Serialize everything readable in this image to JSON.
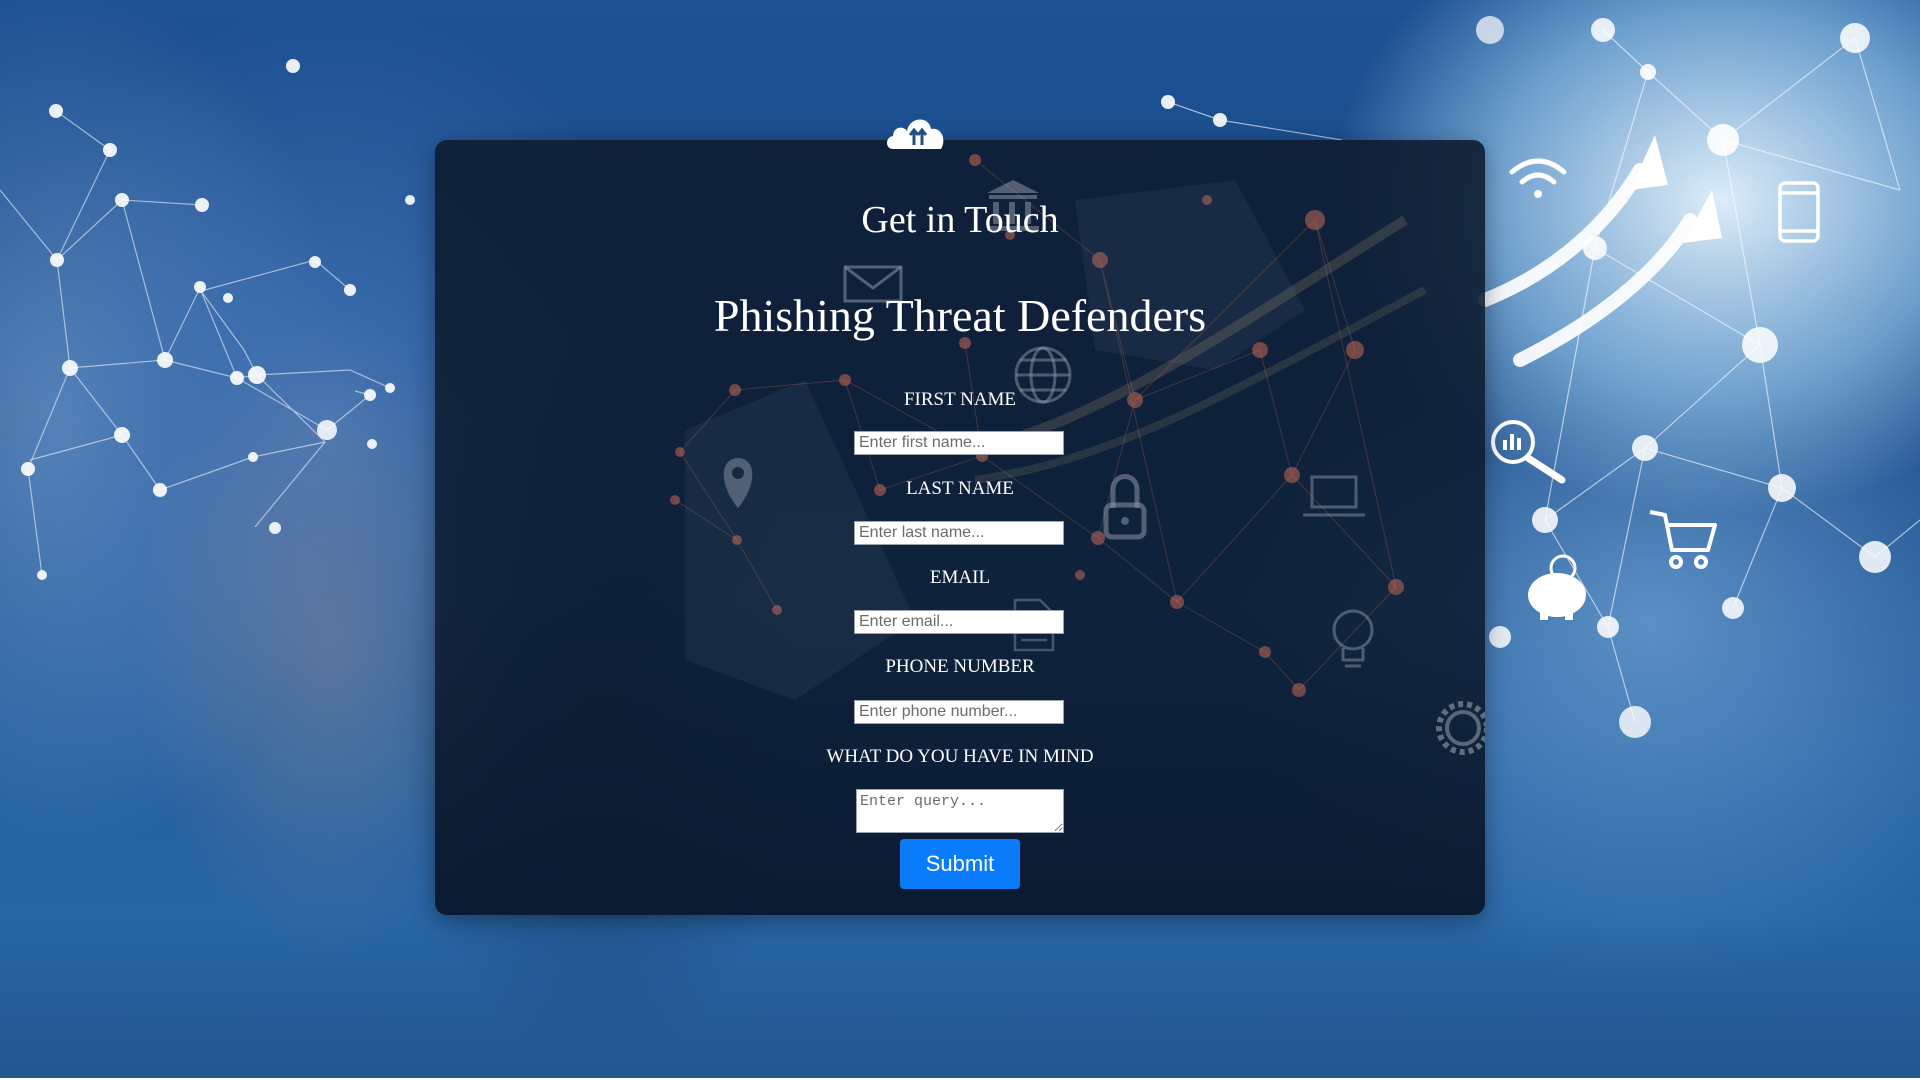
{
  "header": {
    "title": "Get in Touch",
    "subtitle": "Phishing Threat Defenders"
  },
  "form": {
    "fields": [
      {
        "label": "FIRST NAME",
        "placeholder": "Enter first name..."
      },
      {
        "label": "LAST NAME",
        "placeholder": "Enter last name..."
      },
      {
        "label": "EMAIL",
        "placeholder": "Enter email..."
      },
      {
        "label": "PHONE NUMBER",
        "placeholder": "Enter phone number..."
      }
    ],
    "query": {
      "label": "WHAT DO YOU HAVE IN MIND",
      "placeholder": "Enter query..."
    },
    "submit_label": "Submit"
  },
  "colors": {
    "accent": "#0a7bfa",
    "card": "#0e1c30",
    "background": "#1d5193"
  },
  "icons": [
    "cloud-upload-icon",
    "bank-icon",
    "envelope-icon",
    "globe-icon",
    "location-pin-icon",
    "padlock-icon",
    "laptop-icon",
    "document-icon",
    "lightbulb-icon",
    "gear-icon",
    "wifi-icon",
    "smartphone-icon",
    "magnifier-chart-icon",
    "shopping-cart-icon",
    "piggy-bank-icon",
    "growth-arrow-icon"
  ]
}
